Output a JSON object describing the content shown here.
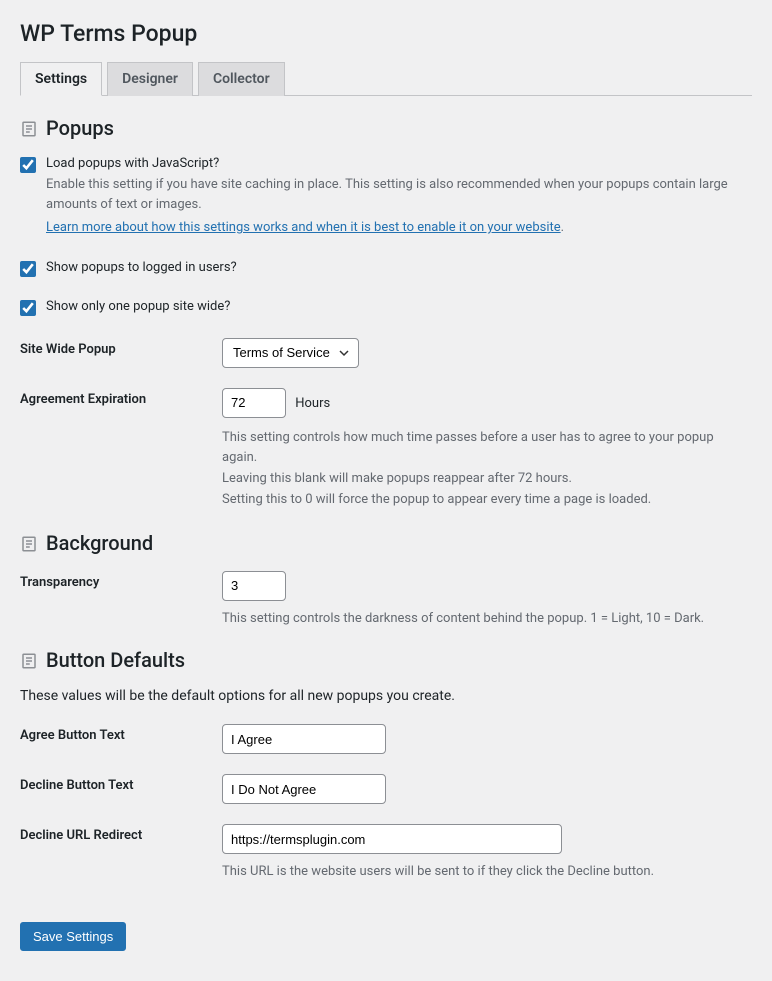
{
  "page_title": "WP Terms Popup",
  "tabs": [
    {
      "label": "Settings",
      "active": true
    },
    {
      "label": "Designer",
      "active": false
    },
    {
      "label": "Collector",
      "active": false
    }
  ],
  "sections": {
    "popups": {
      "title": "Popups",
      "load_js": {
        "label": "Load popups with JavaScript?",
        "checked": true,
        "description": "Enable this setting if you have site caching in place. This setting is also recommended when your popups contain large amounts of text or images.",
        "link_text": "Learn more about how this settings works and when it is best to enable it on your website",
        "link_suffix": "."
      },
      "show_logged_in": {
        "label": "Show popups to logged in users?",
        "checked": true
      },
      "show_one": {
        "label": "Show only one popup site wide?",
        "checked": true
      },
      "site_wide_popup": {
        "label": "Site Wide Popup",
        "value": "Terms of Service"
      },
      "agreement_expiration": {
        "label": "Agreement Expiration",
        "value": "72",
        "unit": "Hours",
        "help1": "This setting controls how much time passes before a user has to agree to your popup again.",
        "help2": "Leaving this blank will make popups reappear after 72 hours.",
        "help3": "Setting this to 0 will force the popup to appear every time a page is loaded."
      }
    },
    "background": {
      "title": "Background",
      "transparency": {
        "label": "Transparency",
        "value": "3",
        "help": "This setting controls the darkness of content behind the popup. 1 = Light, 10 = Dark."
      }
    },
    "button_defaults": {
      "title": "Button Defaults",
      "intro": "These values will be the default options for all new popups you create.",
      "agree_text": {
        "label": "Agree Button Text",
        "value": "I Agree"
      },
      "decline_text": {
        "label": "Decline Button Text",
        "value": "I Do Not Agree"
      },
      "decline_url": {
        "label": "Decline URL Redirect",
        "value": "https://termsplugin.com",
        "help": "This URL is the website users will be sent to if they click the Decline button."
      }
    }
  },
  "save_button": "Save Settings"
}
